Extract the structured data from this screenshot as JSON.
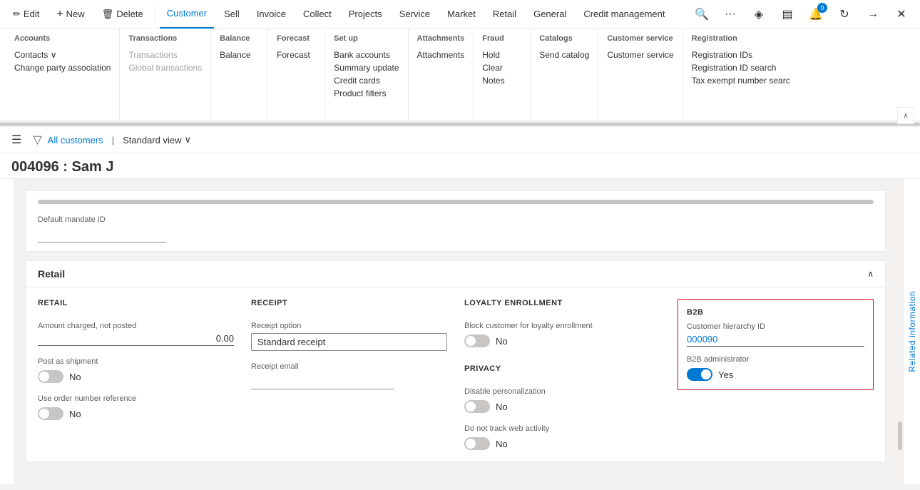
{
  "topnav": {
    "items": [
      {
        "id": "edit",
        "label": "Edit",
        "icon": "✏️",
        "active": false
      },
      {
        "id": "new",
        "label": "New",
        "icon": "+",
        "active": false
      },
      {
        "id": "delete",
        "label": "Delete",
        "icon": "🗑",
        "active": false
      },
      {
        "id": "customer",
        "label": "Customer",
        "active": true
      },
      {
        "id": "sell",
        "label": "Sell",
        "active": false
      },
      {
        "id": "invoice",
        "label": "Invoice",
        "active": false
      },
      {
        "id": "collect",
        "label": "Collect",
        "active": false
      },
      {
        "id": "projects",
        "label": "Projects",
        "active": false
      },
      {
        "id": "service",
        "label": "Service",
        "active": false
      },
      {
        "id": "market",
        "label": "Market",
        "active": false
      },
      {
        "id": "retail",
        "label": "Retail",
        "active": false
      },
      {
        "id": "general",
        "label": "General",
        "active": false
      },
      {
        "id": "credit_management",
        "label": "Credit management",
        "active": false
      }
    ],
    "right_icons": [
      "search",
      "ellipsis",
      "diamond",
      "layers",
      "notification",
      "refresh",
      "forward",
      "close"
    ]
  },
  "megamenu": {
    "groups": [
      {
        "id": "accounts",
        "title": "Accounts",
        "items": [
          {
            "label": "Contacts ∨",
            "disabled": false
          },
          {
            "label": "Change party association",
            "disabled": false
          }
        ]
      },
      {
        "id": "transactions",
        "title": "Transactions",
        "items": [
          {
            "label": "Transactions",
            "disabled": true
          },
          {
            "label": "Global transactions",
            "disabled": true
          }
        ]
      },
      {
        "id": "balance",
        "title": "Balance",
        "items": [
          {
            "label": "Balance",
            "disabled": false
          }
        ]
      },
      {
        "id": "forecast",
        "title": "Forecast",
        "items": [
          {
            "label": "Forecast",
            "disabled": false
          }
        ]
      },
      {
        "id": "setup",
        "title": "Set up",
        "items": [
          {
            "label": "Bank accounts",
            "disabled": false
          },
          {
            "label": "Summary update",
            "disabled": false
          },
          {
            "label": "Credit cards",
            "disabled": false
          },
          {
            "label": "Product filters",
            "disabled": false
          }
        ]
      },
      {
        "id": "attachments",
        "title": "Attachments",
        "items": [
          {
            "label": "Attachments",
            "disabled": false
          }
        ]
      },
      {
        "id": "fraud",
        "title": "Fraud",
        "items": [
          {
            "label": "Hold",
            "disabled": false
          },
          {
            "label": "Clear",
            "disabled": false
          },
          {
            "label": "Notes",
            "disabled": false
          }
        ]
      },
      {
        "id": "catalogs",
        "title": "Catalogs",
        "items": [
          {
            "label": "Send catalog",
            "disabled": false
          }
        ]
      },
      {
        "id": "customer_service",
        "title": "Customer service",
        "items": [
          {
            "label": "Customer service",
            "disabled": false
          }
        ]
      },
      {
        "id": "registration",
        "title": "Registration",
        "items": [
          {
            "label": "Registration IDs",
            "disabled": false
          },
          {
            "label": "Registration ID search",
            "disabled": false
          },
          {
            "label": "Tax exempt number searc",
            "disabled": false
          }
        ]
      }
    ]
  },
  "breadcrumb": {
    "all_customers_label": "All customers",
    "separator": "|",
    "view_label": "Standard view",
    "view_icon": "∨"
  },
  "page": {
    "title": "004096 : Sam J",
    "related_info_label": "Related information"
  },
  "mandate": {
    "label": "Default mandate ID"
  },
  "retail_section": {
    "title": "Retail",
    "retail_col": {
      "title": "RETAIL",
      "amount_label": "Amount charged, not posted",
      "amount_value": "0.00",
      "post_as_shipment_label": "Post as shipment",
      "post_as_shipment_value": "No",
      "post_as_shipment_on": false,
      "use_order_ref_label": "Use order number reference",
      "use_order_ref_value": "No",
      "use_order_ref_on": false
    },
    "receipt_col": {
      "title": "RECEIPT",
      "receipt_option_label": "Receipt option",
      "receipt_option_value": "Standard receipt",
      "receipt_email_label": "Receipt email"
    },
    "loyalty_col": {
      "title": "LOYALTY ENROLLMENT",
      "block_label": "Block customer for loyalty enrollment",
      "block_value": "No",
      "block_on": false,
      "privacy_title": "PRIVACY",
      "disable_personalization_label": "Disable personalization",
      "disable_personalization_value": "No",
      "disable_personalization_on": false,
      "do_not_track_label": "Do not track web activity",
      "do_not_track_value": "No",
      "do_not_track_on": false
    },
    "b2b_col": {
      "title": "B2B",
      "hierarchy_id_label": "Customer hierarchy ID",
      "hierarchy_id_value": "000090",
      "admin_label": "B2B administrator",
      "admin_value": "Yes",
      "admin_on": true
    }
  }
}
